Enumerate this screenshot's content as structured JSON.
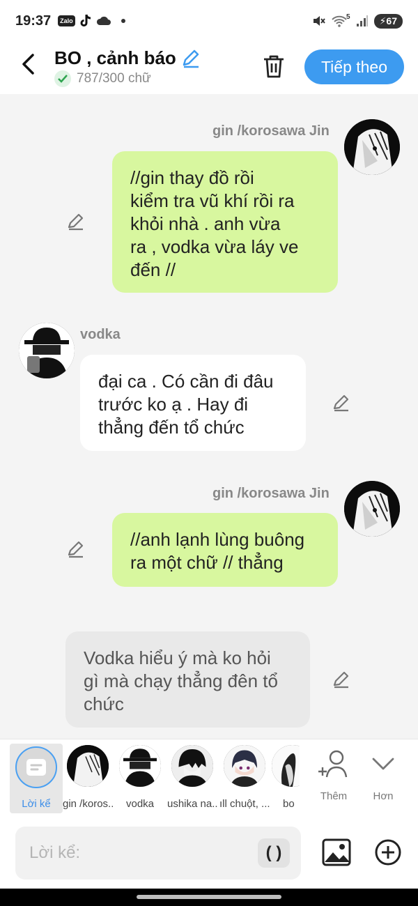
{
  "status": {
    "time": "19:37",
    "zalo": "Zalo",
    "battery": "67",
    "sim_label": "5"
  },
  "header": {
    "title": "BO , cảnh báo",
    "char_count": "787/300 chữ",
    "next_label": "Tiếp theo"
  },
  "messages": [
    {
      "sender": "gin /korosawa Jin",
      "text_lines": [
        "//gin thay đồ rồi",
        "kiểm tra vũ khí rồi ra",
        "khỏi nhà . anh vừa",
        "ra , vodka vừa láy ve",
        "đến //"
      ]
    },
    {
      "sender": "vodka",
      "text_lines": [
        "đại ca . Có cần đi đâu",
        "trước ko ạ . Hay đi",
        "thẳng đến tổ chức"
      ]
    },
    {
      "sender": "gin /korosawa Jin",
      "text_lines": [
        "//anh lạnh lùng buông",
        "ra một chữ // thẳng"
      ]
    },
    {
      "sender": "",
      "text_lines": [
        "Vodka hiểu ý mà ko hỏi",
        "gì mà chạy thẳng đên tổ",
        "chức"
      ]
    }
  ],
  "char_bar": {
    "narration": "Lời kể",
    "items": [
      "gin /koros..",
      "vodka",
      "ushika na..",
      "ıll chuột, ...",
      "bo"
    ],
    "add_label": "Thêm",
    "more_label": "Hơn"
  },
  "input": {
    "placeholder": "Lời kể:",
    "paren": "( )"
  }
}
